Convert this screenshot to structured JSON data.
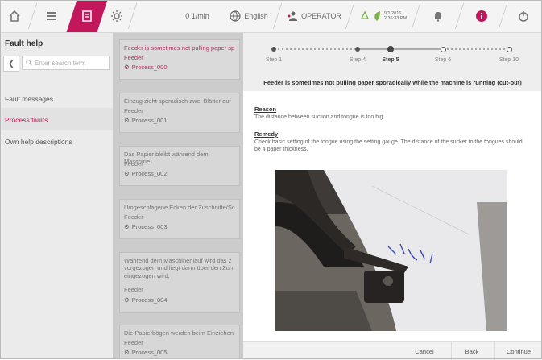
{
  "topbar": {
    "speed": "0 1/min",
    "language": "English",
    "role": "OPERATOR",
    "date": "9/1/2016",
    "time": "2:36:33 PM"
  },
  "left": {
    "title": "Fault help",
    "search_placeholder": "Enter search term",
    "nav": [
      {
        "label": "Fault messages"
      },
      {
        "label": "Process faults"
      },
      {
        "label": "Own help descriptions"
      }
    ]
  },
  "faults": [
    {
      "desc": "Feeder is sometimes not pulling paper sp",
      "feeder": "Feeder",
      "process": "Process_000"
    },
    {
      "desc": "Einzug zieht sporadisch zwei Blätter auf",
      "feeder": "Feeder",
      "process": "Process_001"
    },
    {
      "desc": "Das Papier bleibt während dem Maschine",
      "feeder": "Feeder",
      "process": "Process_002"
    },
    {
      "desc": "Umgeschlagene Ecken der Zuschnitte/Sc",
      "feeder": "Feeder",
      "process": "Process_003"
    },
    {
      "desc": "Während dem Maschinenlauf wird das z vorgezogen und liegt dann über den Zun eingezogen wird.",
      "feeder": "Feeder",
      "process": "Process_004"
    },
    {
      "desc": "Die Papierbögen werden beim Einziehen",
      "feeder": "Feeder",
      "process": "Process_005"
    }
  ],
  "detail": {
    "steps": [
      {
        "label": "Step 1"
      },
      {
        "label": "Step 4"
      },
      {
        "label": "Step 5"
      },
      {
        "label": "Step 6"
      },
      {
        "label": "Step 10"
      }
    ],
    "headline": "Feeder is sometimes not pulling paper sporadically while the machine is running (cut-out)",
    "reason_title": "Reason",
    "reason_text": "The distance between suction and tongue is too big",
    "remedy_title": "Remedy",
    "remedy_text": "Check basic setting of the tongue using the setting gauge. The distance of the sucker to the tongues should be 4 paper thickness.",
    "cancel": "Cancel",
    "back": "Back",
    "continue": "Continue"
  },
  "colors": {
    "accent": "#c2185b",
    "green": "#7cb342"
  }
}
